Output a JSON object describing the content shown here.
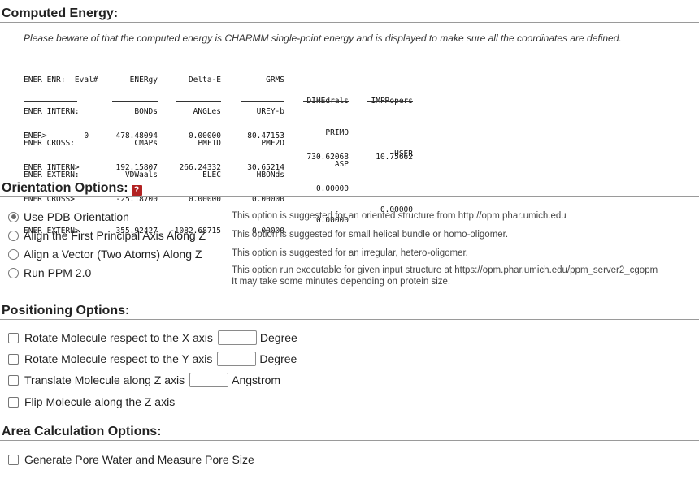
{
  "computed_energy": {
    "title": "Computed Energy:",
    "note": "Please beware of that the computed energy is CHARMM single-point energy and is displayed to make sure all the coordinates are defined.",
    "header_rows": [
      [
        "ENER ENR:  Eval#",
        "ENERgy",
        "Delta-E",
        "GRMS",
        "",
        ""
      ],
      [
        "ENER INTERN:",
        "BONDs",
        "ANGLes",
        "UREY-b",
        "DIHEdrals",
        "IMPRopers"
      ],
      [
        "ENER CROSS:",
        "CMAPs",
        "PMF1D",
        "PMF2D",
        "PRIMO",
        ""
      ],
      [
        "ENER EXTERN:",
        "VDWaals",
        "ELEC",
        "HBONds",
        "ASP",
        "USER"
      ]
    ],
    "data_rows": [
      [
        "ENER>        0",
        "478.48094",
        "0.00000",
        "80.47153",
        "",
        ""
      ],
      [
        "ENER INTERN>",
        "192.15807",
        "266.24332",
        "30.65214",
        "730.62068",
        "10.75662"
      ],
      [
        "ENER CROSS>",
        "-25.18700",
        "0.00000",
        "0.00000",
        "0.00000",
        ""
      ],
      [
        "ENER EXTERN>",
        "355.92427",
        "-1082.68715",
        "0.00000",
        "0.00000",
        "0.00000"
      ]
    ]
  },
  "orientation": {
    "title": "Orientation Options:",
    "help_icon": "?",
    "options": [
      {
        "label": "Use PDB Orientation",
        "checked": true,
        "desc": "This option is suggested for an oriented structure from http://opm.phar.umich.edu"
      },
      {
        "label": "Align the First Principal Axis Along Z",
        "checked": false,
        "desc": "This option is suggested for small helical bundle or homo-oligomer."
      },
      {
        "label": "Align a Vector (Two Atoms) Along Z",
        "checked": false,
        "desc": "This option is suggested for an irregular, hetero-oligomer."
      },
      {
        "label": "Run PPM 2.0",
        "checked": false,
        "desc": "This option run executable for given input structure at https://opm.phar.umich.edu/ppm_server2_cgopm",
        "desc2": "It may take some minutes depending on protein size."
      }
    ]
  },
  "positioning": {
    "title": "Positioning Options:",
    "rotate_x": {
      "label": "Rotate Molecule respect to the X axis",
      "value": "",
      "unit": "Degree"
    },
    "rotate_y": {
      "label": "Rotate Molecule respect to the Y axis",
      "value": "",
      "unit": "Degree"
    },
    "translate_z": {
      "label": "Translate Molecule along Z axis",
      "value": "",
      "unit": "Angstrom"
    },
    "flip_z": {
      "label": "Flip Molecule along the Z axis"
    }
  },
  "area": {
    "title": "Area Calculation Options:",
    "pore": {
      "label": "Generate Pore Water and Measure Pore Size"
    }
  }
}
